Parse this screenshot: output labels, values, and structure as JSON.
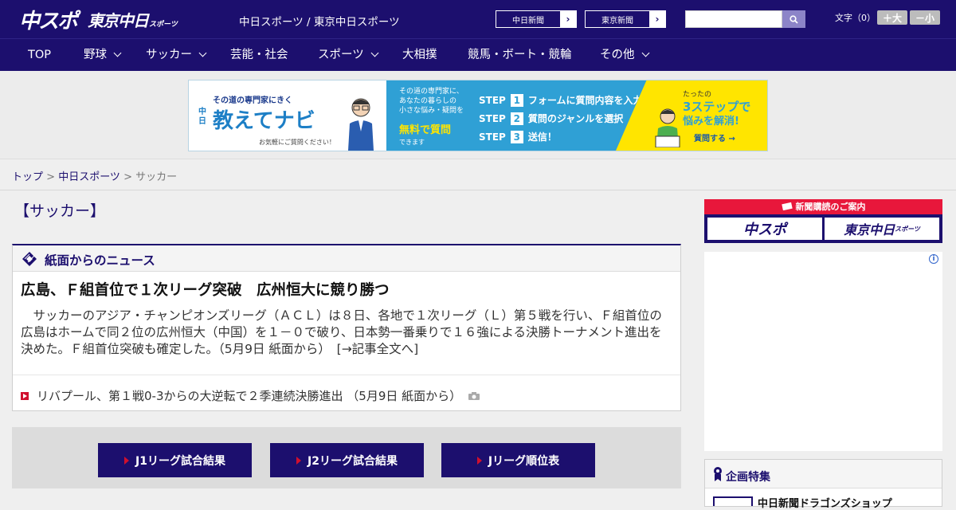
{
  "header": {
    "logo_chuspo": "中スポ",
    "logo_tokyo": "東京中日",
    "logo_tokyo_sub": "スポーツ",
    "site_links": "中日スポーツ / 東京中日スポーツ",
    "paper_buttons": [
      "中日新聞",
      "東京新聞"
    ],
    "search_placeholder": "",
    "font_size_label": "文字（0）",
    "font_larger": "＋大",
    "font_smaller": "－小"
  },
  "nav": {
    "items": [
      {
        "label": "TOP",
        "has_menu": false
      },
      {
        "label": "野球",
        "has_menu": true
      },
      {
        "label": "サッカー",
        "has_menu": true
      },
      {
        "label": "芸能・社会",
        "has_menu": false
      },
      {
        "label": "スポーツ",
        "has_menu": true
      },
      {
        "label": "大相撲",
        "has_menu": false
      },
      {
        "label": "競馬・ボート・競輪",
        "has_menu": false
      },
      {
        "label": "その他",
        "has_menu": true
      }
    ]
  },
  "ad_banner": {
    "tagline": "その道の専門家にきく",
    "brand_prefix": "中日",
    "brand": "教えてナビ",
    "note": "お気軽にご質問ください！",
    "mid_text_1": "その道の専門家に、",
    "mid_text_2": "あなたの暮らしの",
    "mid_text_3": "小さな悩み・疑問を",
    "free": "無料で質問",
    "can": "できます",
    "steps": [
      {
        "step": "STEP",
        "n": "1",
        "text": "フォームに質問内容を入力"
      },
      {
        "step": "STEP",
        "n": "2",
        "text": "質問のジャンルを選択"
      },
      {
        "step": "STEP",
        "n": "3",
        "text": "送信！"
      }
    ],
    "right_1": "たったの",
    "right_2": "3ステップで",
    "right_3": "悩みを解消!",
    "right_4": "質問する →"
  },
  "breadcrumb": {
    "home": "トップ",
    "sep1": " > ",
    "section": "中日スポーツ",
    "sep2": " > ",
    "current": "サッカー"
  },
  "page": {
    "title": "【サッカー】"
  },
  "news": {
    "heading": "紙面からのニュース",
    "headline": "広島、Ｆ組首位で１次リーグ突破　広州恒大に競り勝つ",
    "body": "サッカーのアジア・チャンピオンズリーグ（ＡＣＬ）は８日、各地で１次リーグ（Ｌ）第５戦を行い、Ｆ組首位の広島はホームで同２位の広州恒大（中国）を１－０で破り、日本勢一番乗りで１６強による決勝トーナメント進出を決めた。Ｆ組首位突破も確定した。（5月9日 紙面から）　[→記事全文へ]",
    "sub_item": "リバプール、第１戦0-3からの大逆転で２季連続決勝進出 （5月9日 紙面から）"
  },
  "jleague": {
    "buttons": [
      "J1リーグ試合結果",
      "J2リーグ試合結果",
      "Jリーグ順位表"
    ]
  },
  "sidebar": {
    "subscribe_head": "新聞購読のご案内",
    "subscribe_logo_1": "中スポ",
    "subscribe_logo_2": "東京中日",
    "subscribe_logo_2_sub": "スポーツ",
    "ad_info": "i",
    "feature_head": "企画特集",
    "feature_item": "中日新聞ドラゴンズショップ"
  },
  "colors": {
    "brand_navy": "#1c0f6e",
    "accent_red": "#d0102e",
    "ad_blue": "#2fa0d5",
    "ad_yellow": "#ffe500"
  }
}
